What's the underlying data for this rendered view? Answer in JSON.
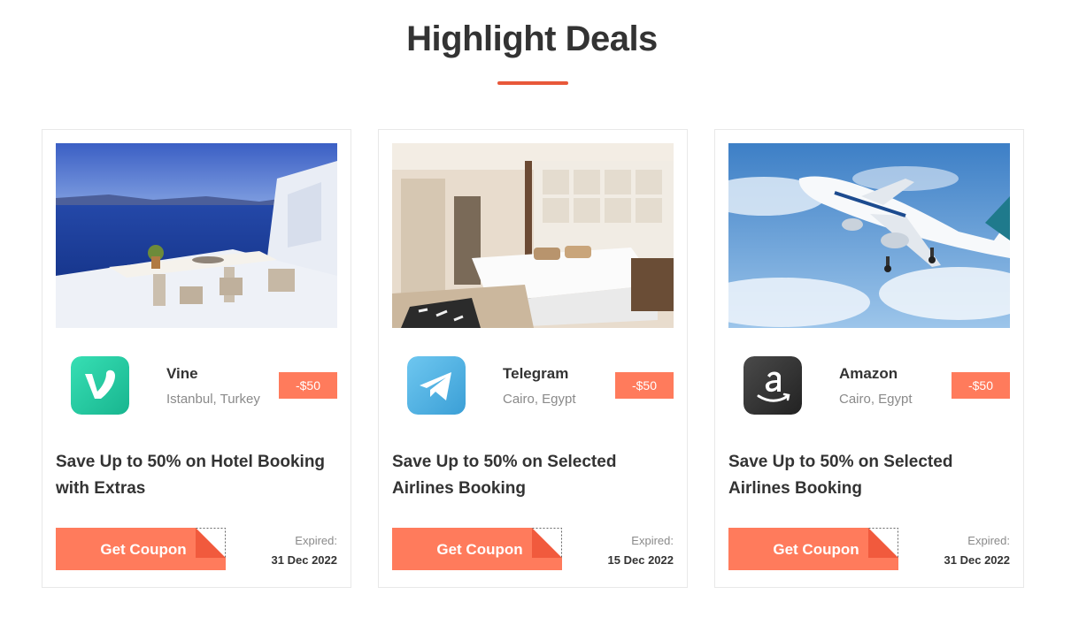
{
  "section": {
    "title": "Highlight Deals",
    "accent_color": "#e8583a"
  },
  "cards": [
    {
      "image_icon": "santorini-terrace-photo",
      "brand": "Vine",
      "brand_icon": "vine-logo-icon",
      "location": "Istanbul, Turkey",
      "discount": "-$50",
      "title": "Save Up to 50% on Hotel Booking with Extras",
      "button_label": "Get Coupon",
      "expired_label": "Expired:",
      "expired_date": "31 Dec 2022"
    },
    {
      "image_icon": "hotel-bedroom-photo",
      "brand": "Telegram",
      "brand_icon": "telegram-logo-icon",
      "location": "Cairo, Egypt",
      "discount": "-$50",
      "title": "Save Up to 50% on Selected Airlines Booking",
      "button_label": "Get Coupon",
      "expired_label": "Expired:",
      "expired_date": "15 Dec 2022"
    },
    {
      "image_icon": "airplane-photo",
      "brand": "Amazon",
      "brand_icon": "amazon-logo-icon",
      "location": "Cairo, Egypt",
      "discount": "-$50",
      "title": "Save Up to 50% on Selected Airlines Booking",
      "button_label": "Get Coupon",
      "expired_label": "Expired:",
      "expired_date": "31 Dec 2022"
    }
  ],
  "colors": {
    "button": "#ff7b5c",
    "badge": "#ff7b5c",
    "fold": "#f15a3d"
  }
}
